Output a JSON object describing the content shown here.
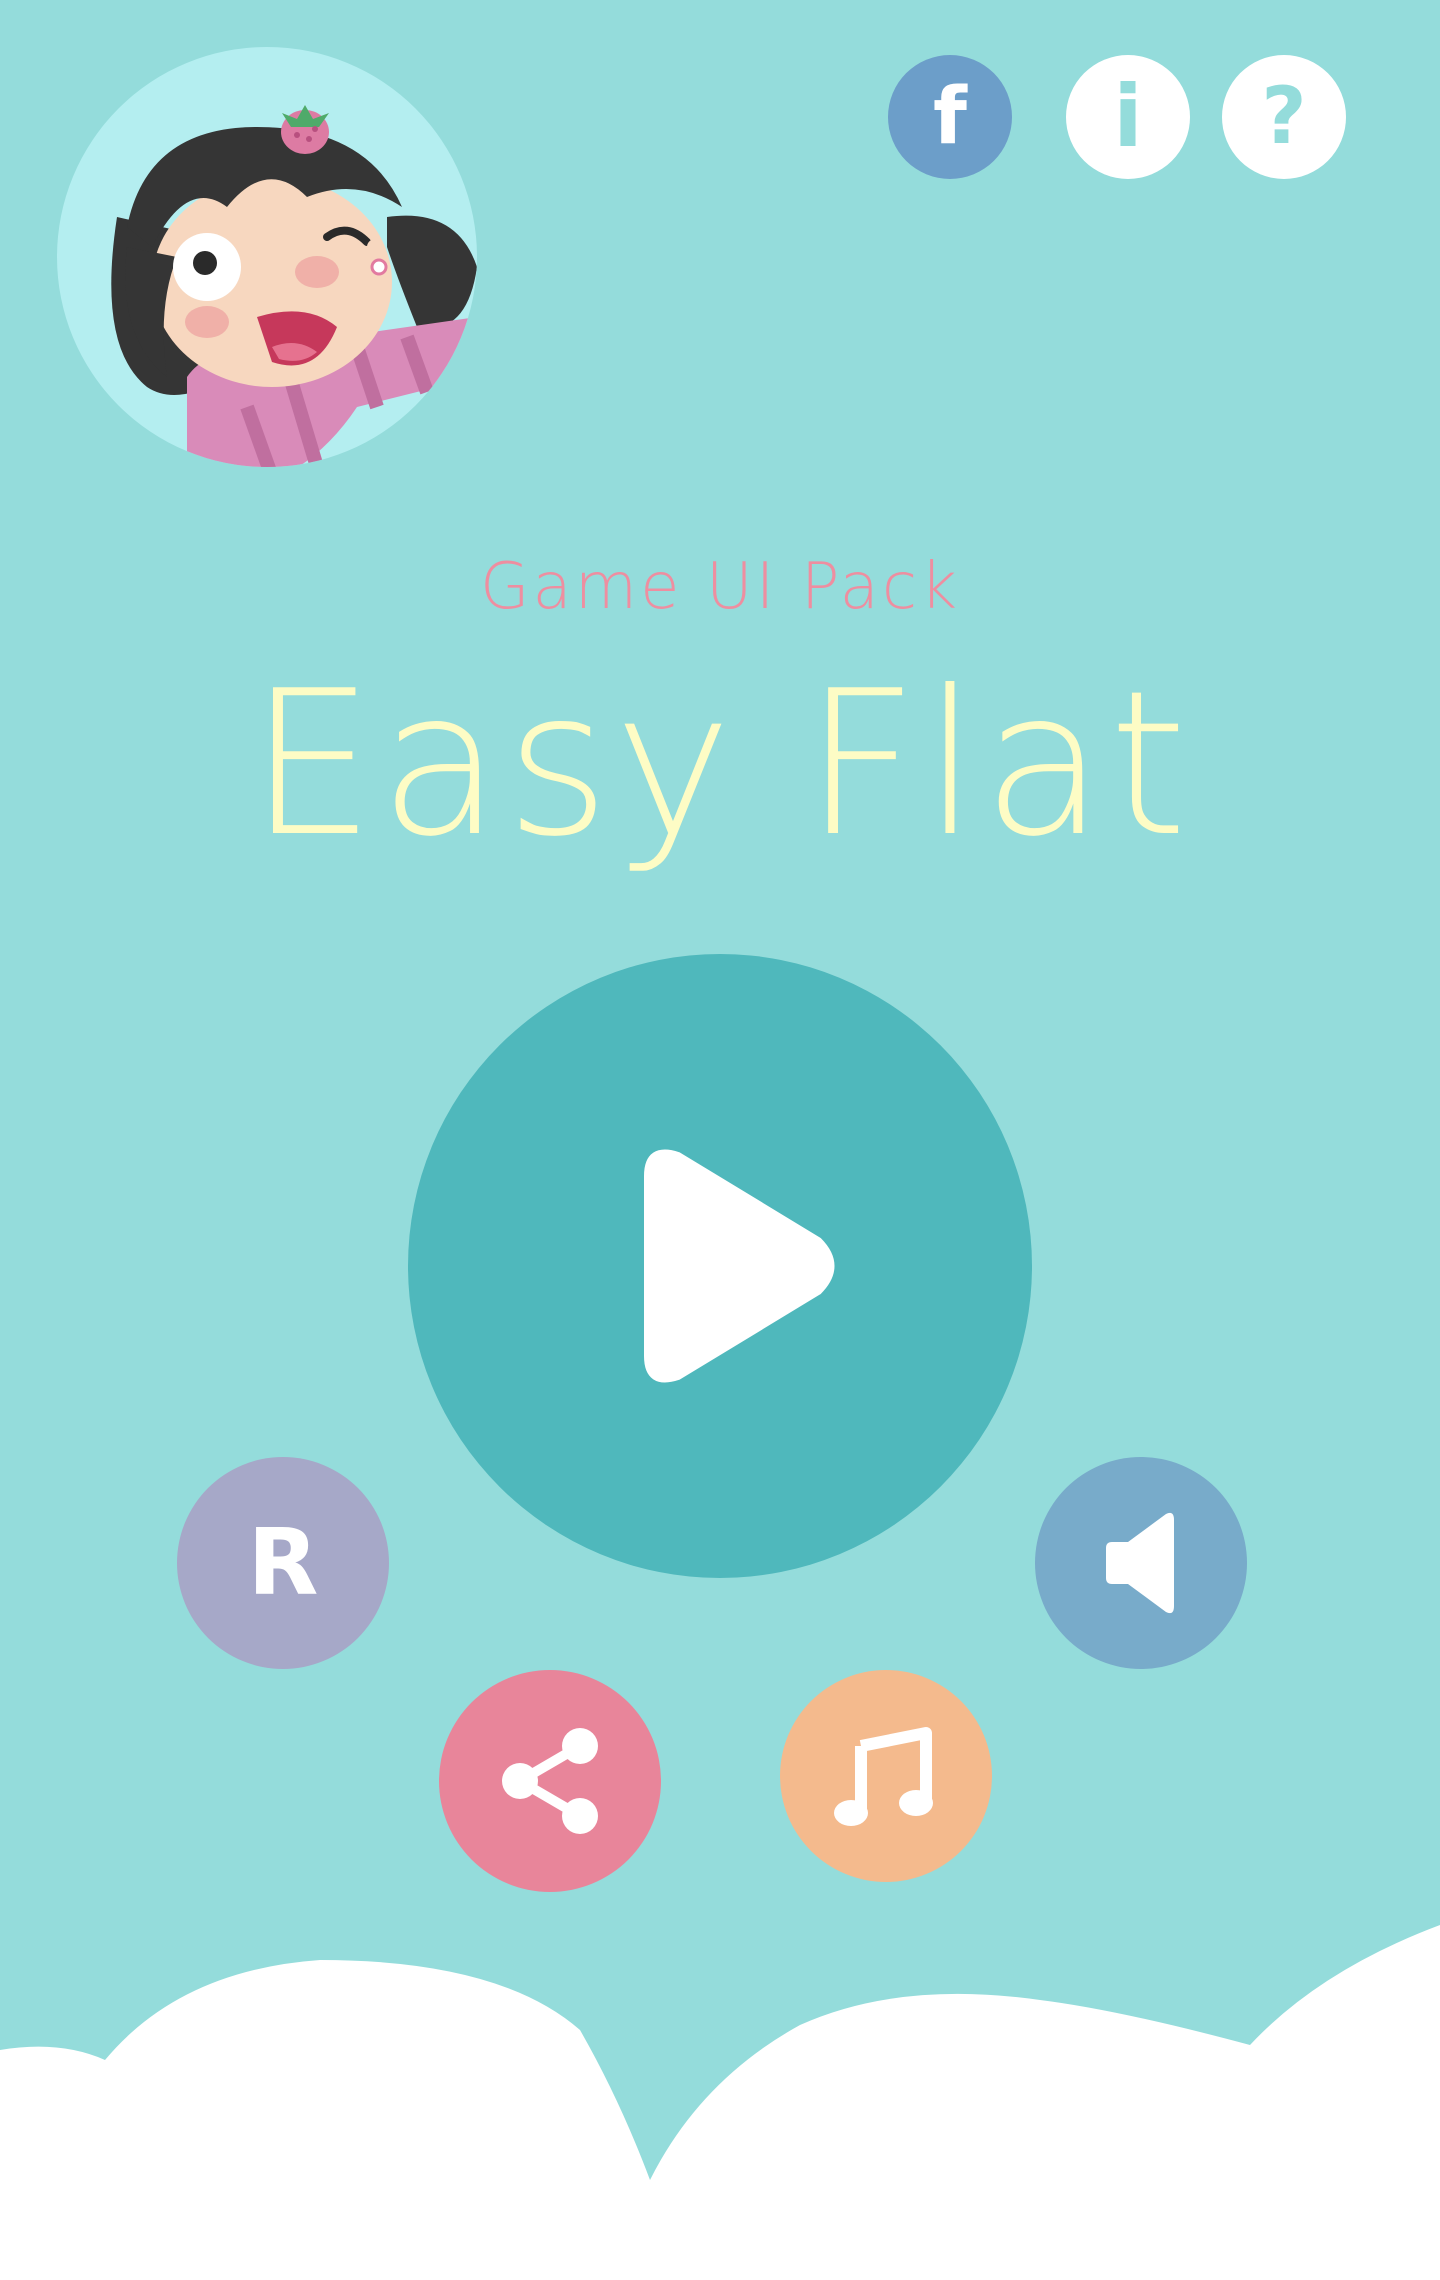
{
  "colors": {
    "background": "#94dcdb",
    "avatar_bg": "#b4eef0",
    "subtitle": "#ee8ea0",
    "title": "#fdfcc5",
    "play": "#4fb8bc",
    "facebook": "#6c9ec9",
    "info": "#ffffff",
    "help": "#ffffff",
    "restart": "#a6a8c8",
    "sound": "#78abca",
    "share": "#e8859a",
    "music": "#f4ba8d",
    "cloud": "#ffffff",
    "icon_light": "#ffffff",
    "icon_accent": "#94dcdb"
  },
  "header": {
    "subtitle": "Game UI Pack",
    "title": "Easy Flat"
  },
  "buttons": {
    "facebook": {
      "label": "f",
      "icon": "facebook-icon"
    },
    "info": {
      "label": "i",
      "icon": "info-icon"
    },
    "help": {
      "label": "?",
      "icon": "help-icon"
    },
    "play": {
      "icon": "play-icon"
    },
    "restart": {
      "label": "R",
      "icon": "restart-icon"
    },
    "sound": {
      "icon": "speaker-icon"
    },
    "share": {
      "icon": "share-icon"
    },
    "music": {
      "icon": "music-note-icon"
    }
  },
  "avatar": {
    "icon": "girl-character-avatar"
  }
}
